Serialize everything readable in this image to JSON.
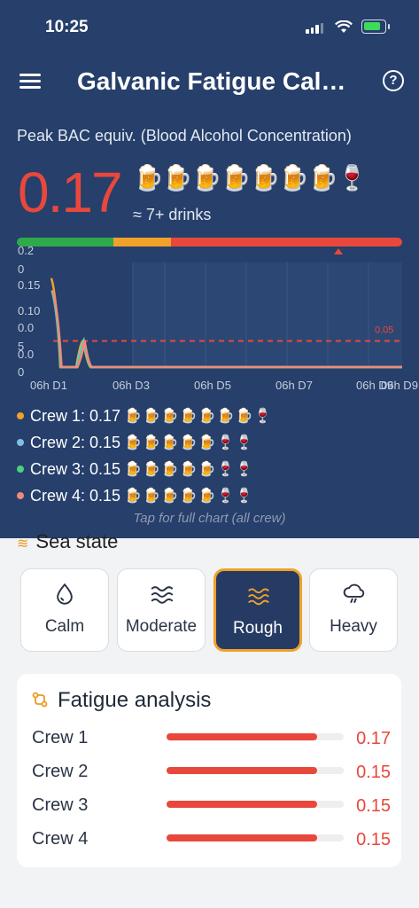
{
  "status": {
    "time": "10:25"
  },
  "header": {
    "title": "Galvanic Fatigue Calculator",
    "help_label": "?"
  },
  "peak": {
    "label": "Peak BAC equiv. (Blood Alcohol Concentration)",
    "value": "0.17",
    "drink_icons": "🍺🍺🍺🍺🍺🍺🍺🍷",
    "drinks_text": "≈ 7+ drinks",
    "level": 0.83
  },
  "risk_bar": {
    "segments": [
      {
        "share": 0.25,
        "color": "#2eaa4a"
      },
      {
        "share": 0.15,
        "color": "#f0a12a"
      },
      {
        "share": 0.6,
        "color": "#e8483c"
      }
    ]
  },
  "chart_data": {
    "type": "line",
    "x_ticks": [
      "06h D1",
      "06h D3",
      "06h D5",
      "06h D7",
      "06h D9",
      "06h D9"
    ],
    "y_ticks_overlapping": [
      "0.2",
      "0",
      "0.15",
      "0.10",
      "0.0",
      "5",
      "0.0",
      "0"
    ],
    "threshold": {
      "value": 0.05,
      "label": "0.05",
      "color": "#e8483c"
    },
    "ylim": [
      0,
      0.2
    ],
    "series": [
      {
        "color": "#f0a12a",
        "peak": 0.17
      },
      {
        "color": "#7fbfe3",
        "peak": 0.15
      },
      {
        "color": "#4cd180",
        "peak": 0.15
      },
      {
        "color": "#f08a7a",
        "peak": 0.15
      }
    ]
  },
  "crew": [
    {
      "label": "Crew 1: 0.17",
      "emoji": "🍺🍺🍺🍺🍺🍺🍺🍷",
      "color": "#f0a12a"
    },
    {
      "label": "Crew 2: 0.15",
      "emoji": "🍺🍺🍺🍺🍺🍷🍷",
      "color": "#7fbfe3"
    },
    {
      "label": "Crew 3: 0.15",
      "emoji": "🍺🍺🍺🍺🍺🍷🍷",
      "color": "#4cd180"
    },
    {
      "label": "Crew 4: 0.15",
      "emoji": "🍺🍺🍺🍺🍺🍷🍷",
      "color": "#f08a7a"
    }
  ],
  "tap_hint": "Tap for full chart (all crew)",
  "sea_state": {
    "heading": "Sea state",
    "options": [
      {
        "label": "Calm",
        "icon": "droplet-icon"
      },
      {
        "label": "Moderate",
        "icon": "waves-icon"
      },
      {
        "label": "Rough",
        "icon": "waves-icon",
        "selected": true
      },
      {
        "label": "Heavy",
        "icon": "storm-icon"
      }
    ]
  },
  "fatigue": {
    "title": "Fatigue analysis",
    "rows": [
      {
        "name": "Crew 1",
        "value": "0.17",
        "level": 0.85
      },
      {
        "name": "Crew 2",
        "value": "0.15",
        "level": 0.85
      },
      {
        "name": "Crew 3",
        "value": "0.15",
        "level": 0.85
      },
      {
        "name": "Crew 4",
        "value": "0.15",
        "level": 0.85
      }
    ]
  }
}
